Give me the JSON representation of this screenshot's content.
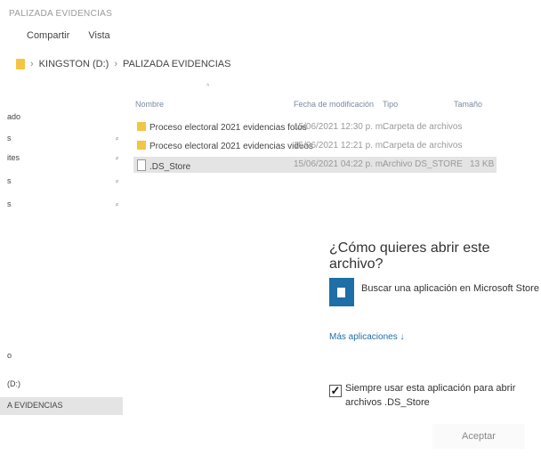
{
  "window": {
    "title": "PALIZADA EVIDENCIAS"
  },
  "ribbon": {
    "tabs": [
      "Compartir",
      "Vista"
    ]
  },
  "breadcrumb": {
    "drive": "KINGSTON (D:)",
    "folder": "PALIZADA EVIDENCIAS"
  },
  "sidebar": {
    "items": [
      "ado",
      "s",
      "ites",
      "s",
      "s",
      "o",
      "(D:)",
      "A EVIDENCIAS"
    ]
  },
  "file_list": {
    "columns": [
      "Nombre",
      "Fecha de modificación",
      "Tipo",
      "Tamaño"
    ],
    "rows": [
      {
        "name": "Proceso electoral 2021 evidencias fotos",
        "date": "15/06/2021 12:30 p. m.",
        "type": "Carpeta de archivos",
        "size": "",
        "kind": "folder",
        "selected": false
      },
      {
        "name": "Proceso electoral 2021 evidencias videos",
        "date": "15/06/2021 12:21 p. m.",
        "type": "Carpeta de archivos",
        "size": "",
        "kind": "folder",
        "selected": false
      },
      {
        "name": ".DS_Store",
        "date": "15/06/2021 04:22 p. m.",
        "type": "Archivo DS_STORE",
        "size": "13 KB",
        "kind": "file",
        "selected": true
      }
    ]
  },
  "dialog": {
    "question": "¿Cómo quieres abrir este archivo?",
    "store_option": "Buscar una aplicación en Microsoft Store",
    "more_apps": "Más aplicaciones ↓",
    "always_use": "Siempre usar esta aplicación para abrir archivos .DS_Store",
    "always_use_checked": true,
    "accept": "Aceptar"
  },
  "colors": {
    "accent": "#1d6fa5",
    "folder": "#f3c542",
    "selection": "#e4e4e4"
  },
  "icons": [
    "folder-icon",
    "file-icon",
    "microsoft-store-icon",
    "pin-icon",
    "checkbox-checked-icon",
    "chevron-right-icon"
  ]
}
